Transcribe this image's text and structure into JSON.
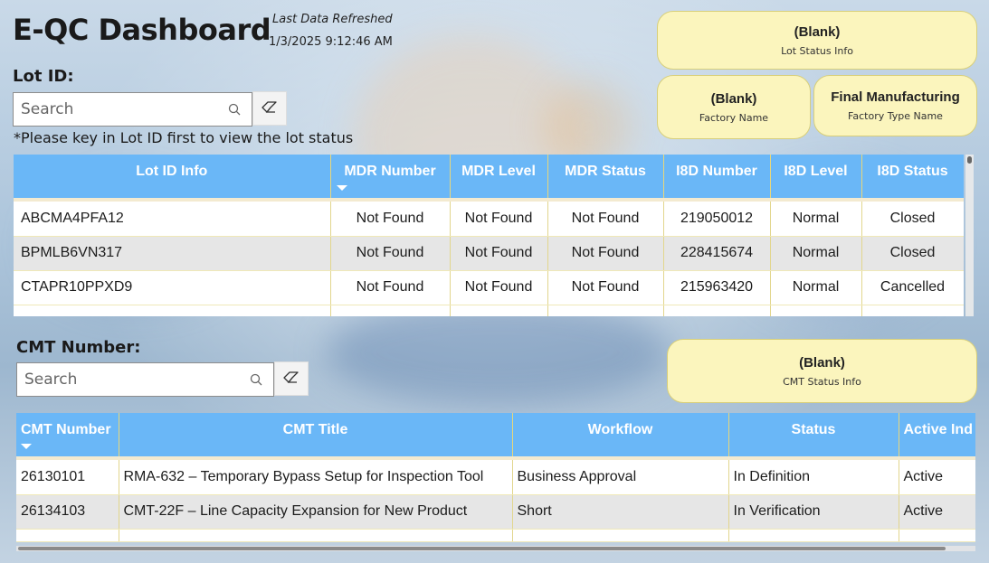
{
  "header": {
    "title": "E-QC Dashboard",
    "refresh_label": "Last Data Refreshed",
    "refresh_value": "1/3/2025 9:12:46 AM"
  },
  "lot": {
    "label": "Lot ID:",
    "search_placeholder": "Search",
    "hint": "*Please key in Lot ID first to view the lot status",
    "columns": [
      "Lot ID Info",
      "MDR Number",
      "MDR Level",
      "MDR Status",
      "I8D Number",
      "I8D Level",
      "I8D Status"
    ],
    "rows": [
      [
        "ABCMA4PFA12",
        "Not Found",
        "Not Found",
        "Not Found",
        "219050012",
        "Normal",
        "Closed"
      ],
      [
        "BPMLB6VN317",
        "Not Found",
        "Not Found",
        "Not Found",
        "228415674",
        "Normal",
        "Closed"
      ],
      [
        "CTAPR10PPXD9",
        "Not Found",
        "Not Found",
        "Not Found",
        "215963420",
        "Normal",
        "Cancelled"
      ]
    ]
  },
  "cards": {
    "lot_status": {
      "value": "(Blank)",
      "label": "Lot Status Info"
    },
    "factory_name": {
      "value": "(Blank)",
      "label": "Factory Name"
    },
    "factory_type": {
      "value": "Final Manufacturing",
      "label": "Factory Type Name"
    },
    "cmt_status": {
      "value": "(Blank)",
      "label": "CMT Status Info"
    }
  },
  "cmt": {
    "label": "CMT Number:",
    "search_placeholder": "Search",
    "columns": [
      "CMT Number",
      "CMT Title",
      "Workflow",
      "Status",
      "Active Ind"
    ],
    "rows": [
      [
        "26130101",
        "RMA-632 – Temporary Bypass Setup for Inspection Tool",
        "Business Approval",
        "In Definition",
        "Active"
      ],
      [
        "26134103",
        "CMT-22F – Line Capacity Expansion for New Product",
        "Short",
        "In Verification",
        "Active"
      ]
    ]
  },
  "colors": {
    "header_blue": "#6ab7f7",
    "card_yellow": "#fbf5bd"
  },
  "icons": [
    "search-icon",
    "eraser-icon",
    "sort-down-icon"
  ]
}
